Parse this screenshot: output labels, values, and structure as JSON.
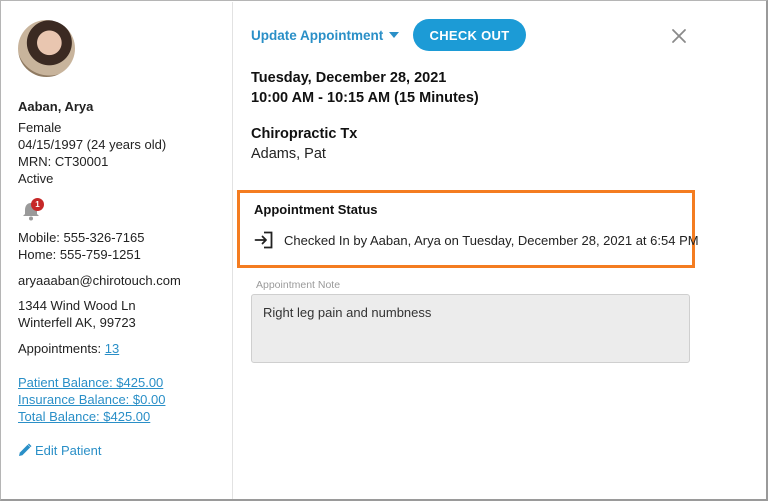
{
  "patient": {
    "name": "Aaban, Arya",
    "gender": "Female",
    "dob": "04/15/1997 (24 years old)",
    "mrn": "MRN: CT30001",
    "status": "Active",
    "notification_count": "1",
    "mobile": "Mobile: 555-326-7165",
    "home": "Home: 555-759-1251",
    "email": "aryaaaban@chirotouch.com",
    "address_line1": "1344 Wind Wood Ln",
    "address_line2": "Winterfell AK, 99723",
    "appointments_label": "Appointments:",
    "appointments_count": "13",
    "patient_balance": "Patient Balance: $425.00",
    "insurance_balance": "Insurance Balance: $0.00",
    "total_balance": "Total Balance: $425.00",
    "edit_label": "Edit Patient"
  },
  "header": {
    "update_label": "Update Appointment",
    "checkout_label": "CHECK OUT"
  },
  "appointment": {
    "date": "Tuesday, December 28, 2021",
    "time": "10:00 AM - 10:15 AM (15 Minutes)",
    "type": "Chiropractic Tx",
    "provider": "Adams, Pat"
  },
  "status": {
    "title": "Appointment Status",
    "text": "Checked In by Aaban, Arya on Tuesday, December 28, 2021 at 6:54 PM"
  },
  "note": {
    "label": "Appointment Note",
    "value": "Right leg pain and numbness"
  },
  "colors": {
    "accent": "#1c9bd6",
    "link": "#2a8fc7",
    "highlight": "#f47c20",
    "badge": "#c62828"
  }
}
